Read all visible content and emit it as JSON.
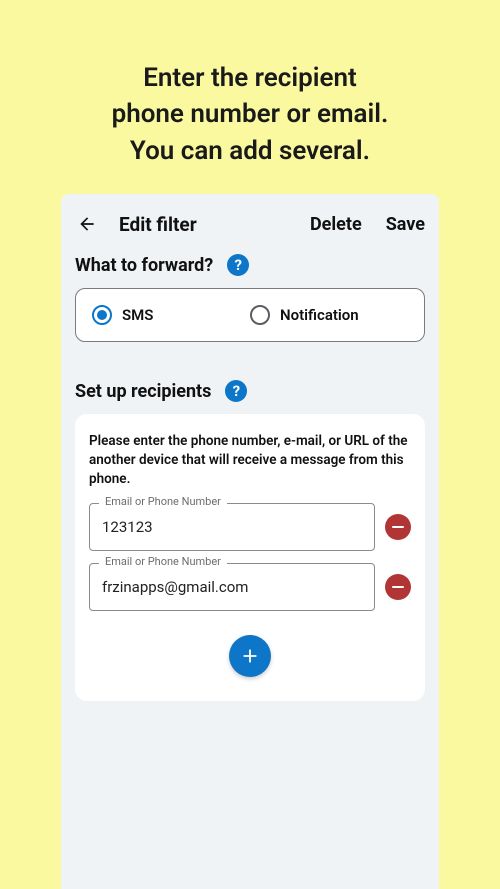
{
  "promo": {
    "line1": "Enter the recipient",
    "line2": "phone number or email.",
    "line3": "You can add several."
  },
  "appbar": {
    "title": "Edit filter",
    "delete": "Delete",
    "save": "Save"
  },
  "forward": {
    "title": "What to forward?",
    "options": {
      "sms": "SMS",
      "notification": "Notification"
    },
    "selected": "sms"
  },
  "recipients": {
    "title": "Set up recipients",
    "instruction": "Please enter the phone number, e-mail, or URL of the another device that will receive a message from this phone.",
    "field_label": "Email or Phone Number",
    "items": [
      {
        "value": "123123"
      },
      {
        "value": "frzinapps@gmail.com"
      }
    ]
  }
}
